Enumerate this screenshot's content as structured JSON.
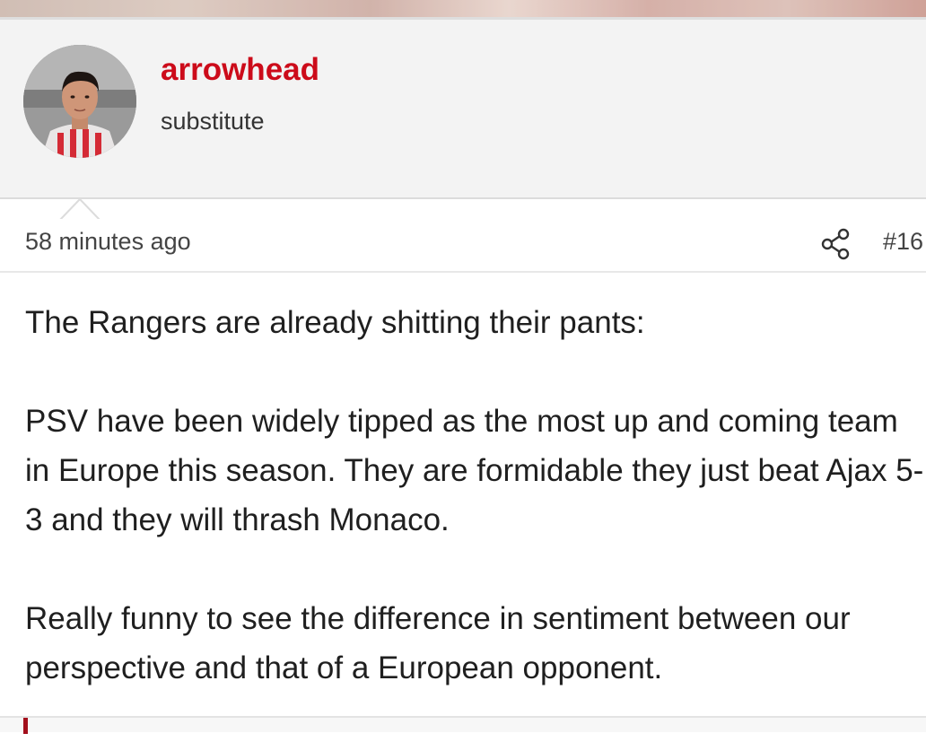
{
  "user": {
    "name": "arrowhead",
    "title": "substitute",
    "avatar_icon": "user-avatar-photo"
  },
  "post": {
    "timestamp": "58 minutes ago",
    "number": "#16",
    "share_icon": "share-icon",
    "paragraphs": [
      "The Rangers are already shitting their pants:",
      "PSV have been widely tipped as the most up and coming team in Europe this season. They are formidable they just beat Ajax 5-3 and they will thrash Monaco.",
      "Really funny to see the difference in sentiment between our perspective and that of a European opponent."
    ]
  },
  "colors": {
    "username": "#cc0b1a",
    "quote_accent": "#a30f1c",
    "panel_bg": "#f3f3f3"
  }
}
